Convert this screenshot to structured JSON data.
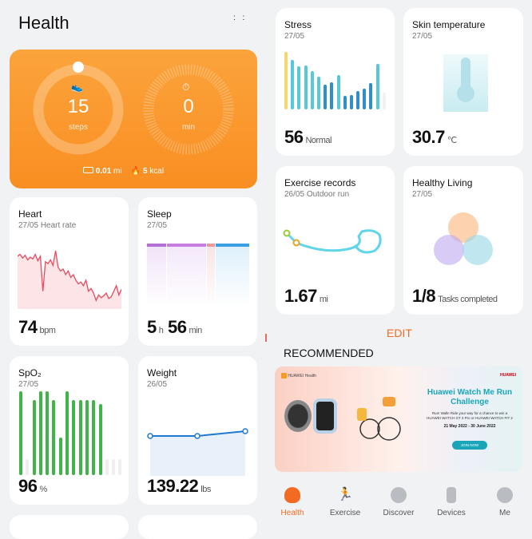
{
  "header": {
    "title": "Health"
  },
  "activity": {
    "steps": "15",
    "steps_unit": "steps",
    "minutes": "0",
    "minutes_unit": "min",
    "distance": "0.01",
    "distance_unit": "mi",
    "calories": "5",
    "calories_unit": "kcal"
  },
  "heart": {
    "title": "Heart",
    "date": "27/05",
    "subtitle": "Heart rate",
    "value": "74",
    "unit": "bpm",
    "trend": [
      78,
      80,
      76,
      79,
      74,
      77,
      75,
      80,
      73,
      78,
      40,
      72,
      70,
      74,
      68,
      84,
      66,
      62,
      64,
      58,
      62,
      55,
      58,
      52,
      48,
      50,
      46,
      52,
      40,
      43,
      38,
      30,
      36,
      33,
      35,
      38,
      32,
      34,
      40,
      46,
      36,
      42
    ]
  },
  "sleep": {
    "title": "Sleep",
    "date": "27/05",
    "hours": "5",
    "h_unit": "h",
    "minutes": "56",
    "m_unit": "min"
  },
  "spo2": {
    "title": "SpO₂",
    "date": "27/05",
    "value": "96",
    "unit": "%",
    "bars": [
      1,
      0,
      0.9,
      1,
      1,
      0.9,
      0.45,
      1,
      0.9,
      0.9,
      0.9,
      0.9,
      0.85,
      0,
      0,
      0
    ]
  },
  "weight": {
    "title": "Weight",
    "date": "26/05",
    "value": "139.22",
    "unit": "lbs",
    "points": [
      139.0,
      139.0,
      139.22
    ]
  },
  "stress": {
    "title": "Stress",
    "date": "27/05",
    "value": "56",
    "label": "Normal",
    "bars": [
      63,
      54,
      47,
      48,
      42,
      36,
      27,
      30,
      38,
      15,
      16,
      20,
      23,
      29,
      50,
      18
    ]
  },
  "skin": {
    "title": "Skin temperature",
    "date": "27/05",
    "value": "30.7",
    "unit": "℃"
  },
  "exercise": {
    "title": "Exercise records",
    "date": "26/05",
    "type": "Outdoor run",
    "value": "1.67",
    "unit": "mi"
  },
  "living": {
    "title": "Healthy Living",
    "date": "27/05",
    "value": "1/8",
    "label": "Tasks completed"
  },
  "edit_label": "EDIT",
  "recommended": {
    "title": "RECOMMENDED",
    "banner": {
      "app": "HUAWEI Health",
      "brand": "HUAWEI",
      "headline": "Huawei Watch Me Run Challenge",
      "body": "Run! Walk! Ride your way for a chance to win a HUAWEI WATCH GT 3 Pro or HUAWEI WATCH FIT 2",
      "dates": "21 May 2022 - 30 June 2022",
      "cta": "JOIN NOW"
    }
  },
  "nav": [
    {
      "label": "Health",
      "icon": "heart-icon",
      "active": true
    },
    {
      "label": "Exercise",
      "icon": "runner-icon"
    },
    {
      "label": "Discover",
      "icon": "globe-icon"
    },
    {
      "label": "Devices",
      "icon": "watch-icon"
    },
    {
      "label": "Me",
      "icon": "person-icon"
    }
  ],
  "colors": {
    "accent": "#f26b22",
    "orange_card": "#fb9a32",
    "heart": "#e84a5f",
    "spo2": "#3fb549",
    "stress": "#56c8d8",
    "weight": "#1f78d1"
  }
}
